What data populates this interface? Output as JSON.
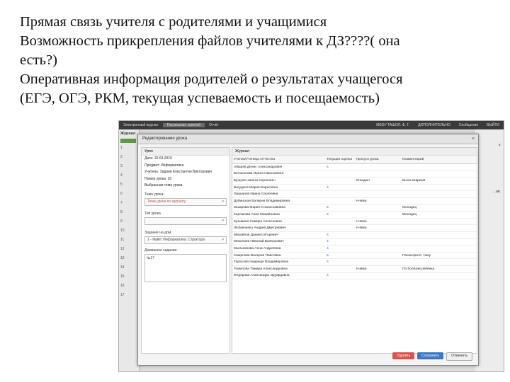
{
  "slide": {
    "lines": [
      "Прямая связь учителя с родителями и учащимися",
      "Возможность прикрепления файлов учителями к ДЗ????( она",
      "есть?)",
      "Оперативная информация родителей о результатах учащегося",
      "(ЕГЭ, ОГЭ, РКМ, текущая успеваемость и посещаемость)"
    ]
  },
  "app": {
    "nav": [
      "Электронный журнал",
      "Расписание занятий",
      "Отчёт",
      "МБОУ ТАШОЛ. Ф. Т.",
      "ДОПОЛНИТЕЛЬНО",
      "Сообщения",
      "ВЫЙТИ"
    ],
    "left_title": "Журнал",
    "left_rows": [
      "1",
      "2",
      "3",
      "4",
      "5",
      "6",
      "7",
      "8",
      "9",
      "10",
      "11",
      "12",
      "13",
      "14",
      "15",
      "16",
      "17"
    ],
    "right_close": "×",
    "right_text": "...ав."
  },
  "dialog": {
    "title": "Редактирование урока",
    "close": "×",
    "left_header": "Урок",
    "date_label": "Дата:",
    "date_value": "20.03.2015",
    "subject": "Предмет: Информатика",
    "teacher": "Учитель: Задоев Константин Викторович",
    "lesson_num": "Номер урока: 35",
    "lesson_status": "Выбранная тема урока",
    "topic_label": "Тема урока:",
    "topic_value": "Тема урока по журналу",
    "type_label": "Тип урока",
    "type_value": "",
    "hw_label": "Задание на дом",
    "file_value": "1 - Файл: Информатика. Структура",
    "homework_label": "Домашнее задание:",
    "homework_value": "№17",
    "right_header": "Журнал",
    "columns": [
      "Ученик/Ученица Отчество",
      "Текущая оценка",
      "Пропуск урока",
      "Комментарий"
    ],
    "rows": [
      [
        "Абашев Денис Александрович",
        "4",
        "",
        ""
      ],
      [
        "Белоконова Ирина Николаевна",
        "",
        "",
        ""
      ],
      [
        "Бушуев Никита Сергеевич",
        "",
        "Опоздал",
        "Была вовремя"
      ],
      [
        "Вагудина Мария Борисовна",
        "4",
        "",
        ""
      ],
      [
        "Гришанов Ирина Сергеевна",
        "",
        "",
        ""
      ],
      [
        "Дубинская Валерия Владимировна",
        "",
        "Н-явка",
        ""
      ],
      [
        "Захарова Мария Станиславовна",
        "5",
        "",
        "Молодец"
      ],
      [
        "Корсакова Анна Михайловна",
        "5",
        "",
        "Молодец"
      ],
      [
        "Кузьмина Самира Алексеевна",
        "",
        "Н-явка",
        ""
      ],
      [
        "Любавченко Андрей Дмитриевич",
        "",
        "Н-явка",
        ""
      ],
      [
        "Михайлов Даниил Игоревич",
        "4",
        "",
        ""
      ],
      [
        "Миколаев Николай Валерьевич",
        "4",
        "",
        ""
      ],
      [
        "Мыльникова Анна Андреевна",
        "4",
        "",
        ""
      ],
      [
        "Смирнова Валерия Павловна",
        "5",
        "",
        "Посмотрите, тему"
      ],
      [
        "Тарасова Надежда Владимировна",
        "4",
        "",
        ""
      ],
      [
        "Томилова Тамара Александровна",
        "",
        "Н-явка",
        "По болезни ребёнка"
      ],
      [
        "Федорова Александра Эдуардовна",
        "4",
        "",
        ""
      ]
    ],
    "btn_delete": "Удалить",
    "btn_save": "Сохранить",
    "btn_cancel": "Отменить"
  }
}
